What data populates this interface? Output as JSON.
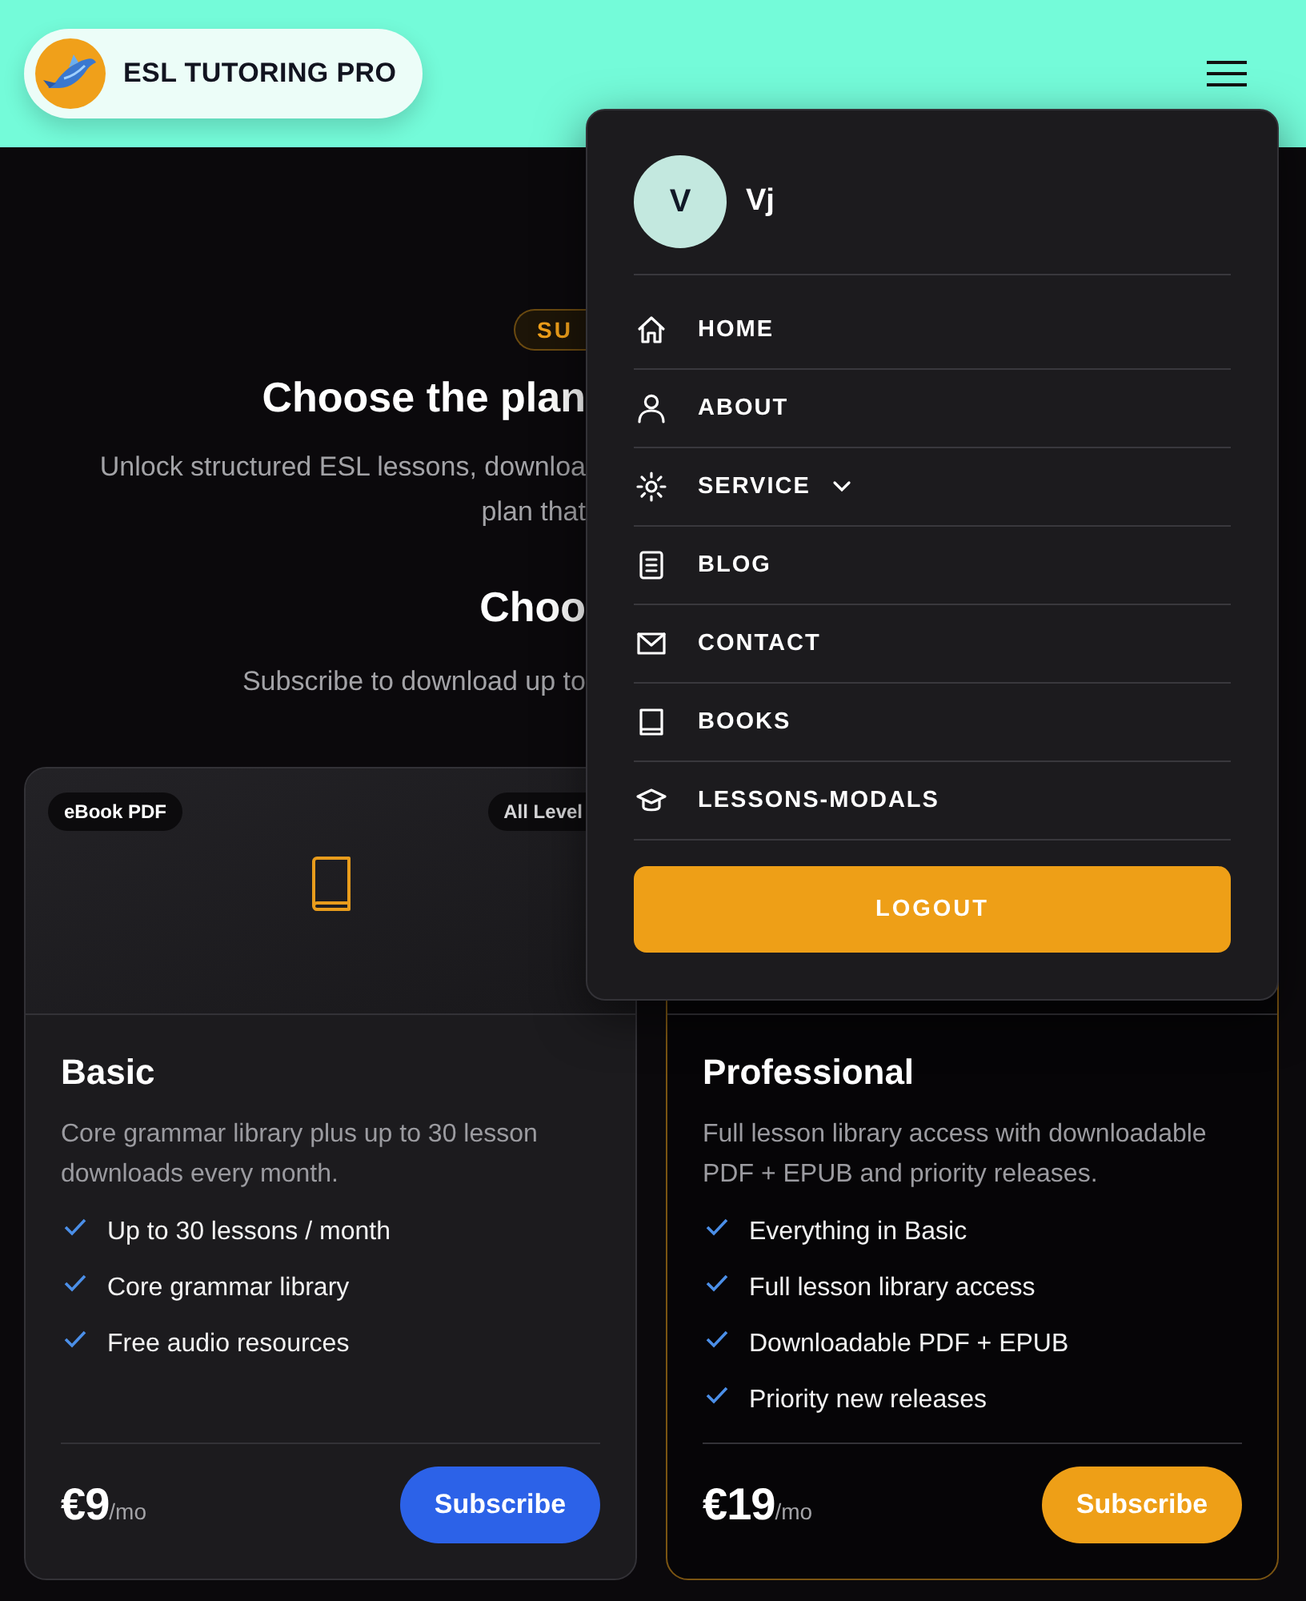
{
  "header": {
    "brand": "ESL TUTORING PRO"
  },
  "hero": {
    "badge": "SU",
    "title": "Choose the plan",
    "subtitle_fragments": [
      "Unlock structured ESL lessons, downloa",
      "plan that"
    ],
    "section_title": "Choo",
    "section_subtitle": "Subscribe to download up to"
  },
  "plans": [
    {
      "name": "Basic",
      "featured": false,
      "tags": [
        "eBook PDF",
        "All Level"
      ],
      "description": "Core grammar library plus up to 30 lesson downloads every month.",
      "features": [
        "Up to 30 lessons / month",
        "Core grammar library",
        "Free audio resources"
      ],
      "price": "€9",
      "period": "/mo",
      "action": "Subscribe"
    },
    {
      "name": "Professional",
      "featured": true,
      "description": "Full lesson library access with downloadable PDF + EPUB and priority releases.",
      "features": [
        "Everything in Basic",
        "Full lesson library access",
        "Downloadable PDF + EPUB",
        "Priority new releases"
      ],
      "price": "€19",
      "period": "/mo",
      "action": "Subscribe"
    }
  ],
  "menu": {
    "user": {
      "initial": "V",
      "name": "Vj"
    },
    "items": [
      {
        "label": "HOME",
        "kind": "link"
      },
      {
        "label": "ABOUT",
        "kind": "link"
      },
      {
        "label": "SERVICE",
        "kind": "dropdown"
      },
      {
        "label": "BLOG",
        "kind": "link"
      },
      {
        "label": "CONTACT",
        "kind": "link"
      },
      {
        "label": "BOOKS",
        "kind": "link"
      },
      {
        "label": "LESSONS-MODALS",
        "kind": "link"
      }
    ],
    "logout": "LOGOUT"
  }
}
